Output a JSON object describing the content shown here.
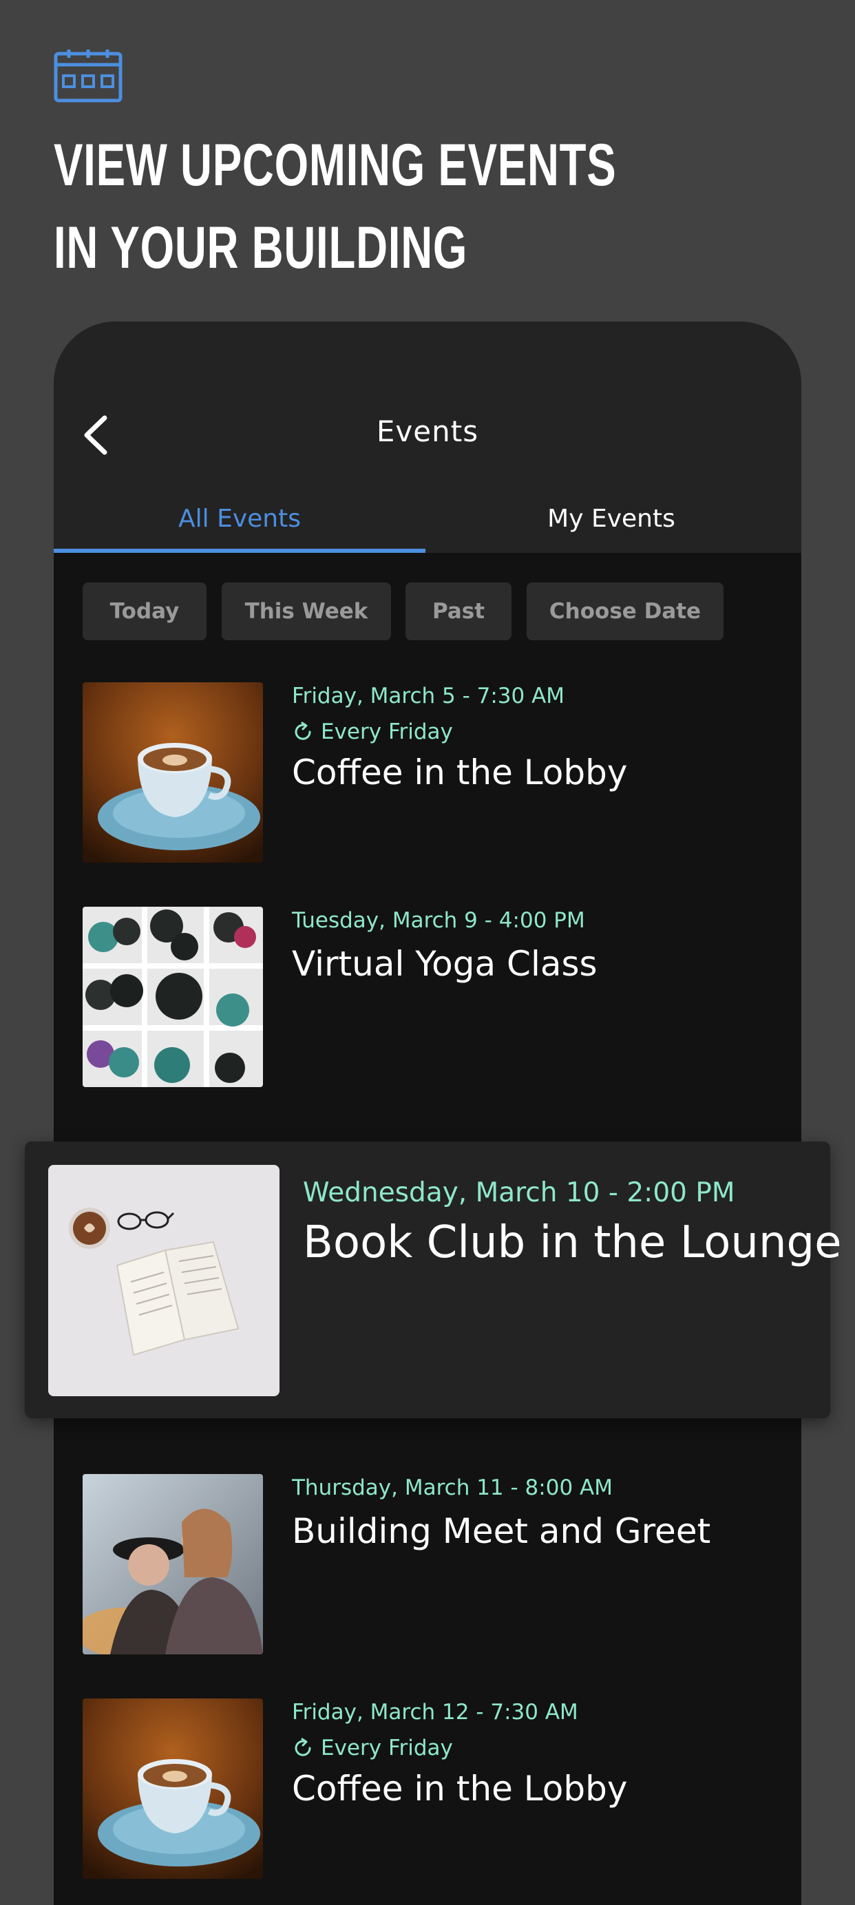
{
  "headline": {
    "line1": "VIEW UPCOMING EVENTS",
    "line2": "IN YOUR BUILDING"
  },
  "colors": {
    "accent": "#4c8fe0",
    "date": "#8ee8c8",
    "background": "#424242",
    "panel": "#232323"
  },
  "icons": {
    "top": "calendar-icon",
    "back": "chevron-left-icon",
    "repeat": "repeat-icon"
  },
  "nav": {
    "title": "Events"
  },
  "tabs": [
    {
      "label": "All Events",
      "active": true
    },
    {
      "label": "My Events",
      "active": false
    }
  ],
  "filters": [
    {
      "label": "Today"
    },
    {
      "label": "This Week"
    },
    {
      "label": "Past"
    },
    {
      "label": "Choose Date"
    }
  ],
  "events": [
    {
      "date": "Friday, March 5 - 7:30 AM",
      "repeat": "Every Friday",
      "title": "Coffee in the Lobby",
      "image": "coffee-cup"
    },
    {
      "date": "Tuesday, March 9 - 4:00 PM",
      "title": "Virtual Yoga Class",
      "image": "yoga-mats"
    },
    {
      "date": "Wednesday, March 10 - 2:00 PM",
      "title": "Book Club in the Lounge",
      "image": "open-book"
    },
    {
      "date": "Thursday, March 11 - 8:00 AM",
      "title": "Building Meet and Greet",
      "image": "people"
    },
    {
      "date": "Friday, March 12 - 7:30 AM",
      "repeat": "Every Friday",
      "title": "Coffee in the Lobby",
      "image": "coffee-cup"
    }
  ]
}
